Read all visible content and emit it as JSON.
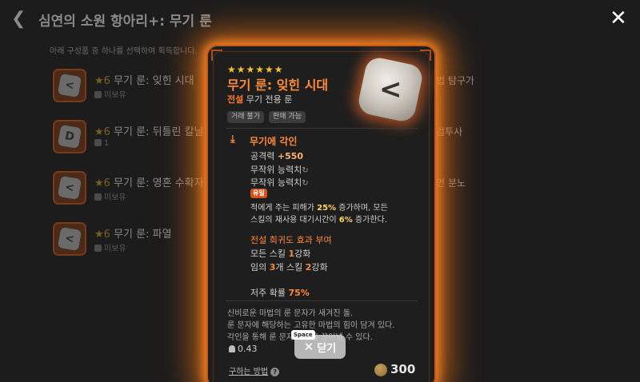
{
  "header": {
    "title": "심연의 소원 항아리+: 무기 룬",
    "subtitle": "아래 구성품 중 하나를 선택하여 획득합니다."
  },
  "list": {
    "items": [
      {
        "star_label": "★6",
        "name": "무기 룬: 잊힌 시대",
        "owned": "미보유"
      },
      {
        "star_label": "★6",
        "name": "무기 룬: 뒤틀린 칼날",
        "owned": "1"
      },
      {
        "star_label": "★6",
        "name": "무기 룬: 영혼 수확자",
        "owned": "미보유"
      },
      {
        "star_label": "★6",
        "name": "무기 룬: 파열",
        "owned": "미보유"
      }
    ],
    "right_labels": [
      "법 탐구가",
      "검투사",
      "먼 분노"
    ]
  },
  "tooltip": {
    "stars": "★★★★★★",
    "name": "무기 룬: 잊힌 시대",
    "grade": "전설",
    "type": "무기 전용 룬",
    "tags": [
      "거래 불가",
      "판매 가능"
    ],
    "engrave_title": "무기에 각인",
    "attack_label": "공격력",
    "attack_value": "+550",
    "random_stat_1": "무작위 능력치",
    "random_stat_2": "무작위 능력치",
    "unique_badge": "유일",
    "effect_line_1_a": "적에게 주는 피해가 ",
    "effect_line_1_b": "25%",
    "effect_line_1_c": " 증가하며, 모든",
    "effect_line_2_a": "스킬의 재사용 대기시간이 ",
    "effect_line_2_b": "6%",
    "effect_line_2_c": " 증가한다.",
    "legend_title": "전설 희귀도 효과 부여",
    "legend_1_a": "모든 스킬 ",
    "legend_1_b": "1",
    "legend_1_c": "강화",
    "legend_2_a": "임의 ",
    "legend_2_b": "3",
    "legend_2_c": "개 스킬 ",
    "legend_2_d": "2",
    "legend_2_e": "강화",
    "curse_label": "저주 확률 ",
    "curse_value": "75%",
    "lore_1": "신비로운 마법의 룬 문자가 새겨진 돌.",
    "lore_2": "룬 문자에 해당하는 고유한 마법의 힘이 담겨 있다.",
    "lore_3": "각인을 통해 룬 문자의 힘을 끌어낼 수 있다.",
    "weight": "0.43",
    "howto": "구하는 방법",
    "price": "300"
  },
  "close_button": {
    "label": "닫기",
    "key_hint": "Space"
  },
  "colors": {
    "accent": "#ff8a3a",
    "glow": "#ff7814",
    "gold": "#f2c232"
  }
}
